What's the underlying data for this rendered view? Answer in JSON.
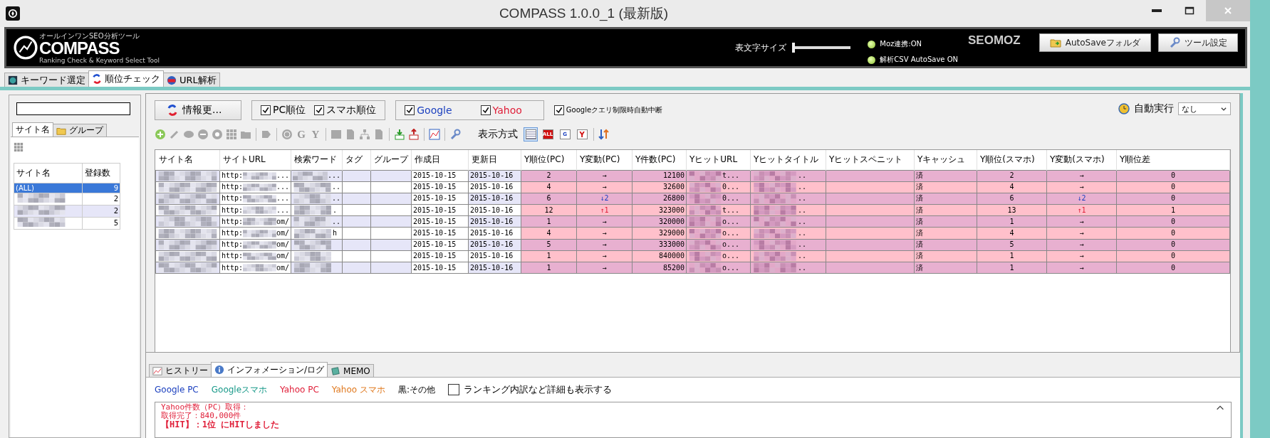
{
  "window": {
    "title": "COMPASS 1.0.0_1 (最新版)"
  },
  "banner": {
    "logo": "COMPASS",
    "logo_tagline": "オールインワンSEO分析ツール",
    "logo_subtitle": "Ranking Check & Keyword Select Tool",
    "font_size_label": "表文字サイズ",
    "font_size": {
      "level": 0
    },
    "statuses": [
      {
        "label": "Moz連携:ON",
        "on": true
      },
      {
        "label": "解析CSV AutoSave ON",
        "on": true
      }
    ],
    "partner_logo": "SEOMOZ",
    "buttons": [
      {
        "kind": "folder",
        "label": "AutoSaveフォルダ"
      },
      {
        "kind": "wrench",
        "label": "ツール設定"
      }
    ]
  },
  "main_tabs": [
    {
      "kind": "keyword",
      "label": "キーワード選定",
      "selected": false
    },
    {
      "kind": "rank",
      "label": "順位チェック",
      "selected": true
    },
    {
      "kind": "url",
      "label": "URL解析",
      "selected": false
    }
  ],
  "sidebar": {
    "tabs": [
      {
        "label": "サイト名",
        "selected": true
      },
      {
        "label": "グループ",
        "selected": false
      }
    ],
    "columns": [
      "サイト名",
      "登録数"
    ],
    "rows": [
      {
        "name": "(ALL)",
        "count": "9",
        "selected": true
      },
      {
        "blurred": true,
        "count": "2",
        "selected": false
      },
      {
        "blurred": true,
        "count": "2",
        "selected": false
      },
      {
        "blurred": true,
        "count": "5",
        "selected": false
      }
    ]
  },
  "toolbar": {
    "update_button": "情報更...",
    "device_checks": [
      {
        "label": "PC順位",
        "checked": true
      },
      {
        "label": "スマホ順位",
        "checked": true
      }
    ],
    "engine_checks": [
      {
        "label": "Google",
        "checked": true,
        "color": "#1a3fbf"
      },
      {
        "label": "Yahoo",
        "checked": true,
        "color": "#e0203a"
      }
    ],
    "auto_stop": {
      "label": "Googleクエリ制限時自動中断",
      "checked": true
    },
    "auto_run_label": "自動実行",
    "auto_run_value": "なし",
    "glyphs": [
      "G",
      "Y"
    ],
    "display_label": "表示方式",
    "display_modes": [
      {
        "kind": "list",
        "selected": true
      },
      {
        "kind": "all",
        "label": "ALL",
        "selected": false
      },
      {
        "kind": "google",
        "label": "G",
        "selected": false
      },
      {
        "kind": "yahoo",
        "label": "Y",
        "selected": false
      }
    ]
  },
  "table": {
    "columns": [
      "サイト名",
      "サイトURL",
      "検索ワード",
      "タグ",
      "グループ",
      "作成日",
      "更新日",
      "Y順位(PC)",
      "Y変動(PC)",
      "Y件数(PC)",
      "YヒットURL",
      "Yヒットタイトル",
      "Yヒットスペニット",
      "Yキャッシュ",
      "Y順位(スマホ)",
      "Y変動(スマホ)",
      "Y順位差"
    ],
    "rows": [
      {
        "url_start": "http:",
        "url_end": "...",
        "keyword_end": "...",
        "created": "2015-10-15",
        "updated": "2015-10-16",
        "rank_pc": "2",
        "change_pc": {
          "text": "→"
        },
        "count_pc": "12100",
        "hit_url_end": "t...",
        "hit_title_end": "..",
        "cache": "済",
        "rank_sp": "2",
        "change_sp": {
          "text": "→"
        },
        "diff": "0"
      },
      {
        "url_start": "http:",
        "url_end": "...",
        "keyword_end": "..",
        "created": "2015-10-15",
        "updated": "2015-10-16",
        "rank_pc": "4",
        "change_pc": {
          "text": "→"
        },
        "count_pc": "32600",
        "hit_url_end": "0...",
        "hit_title_end": "..",
        "cache": "済",
        "rank_sp": "4",
        "change_sp": {
          "text": "→"
        },
        "diff": "0"
      },
      {
        "url_start": "http:",
        "url_end": "...",
        "keyword_end": "..",
        "created": "2015-10-15",
        "updated": "2015-10-16",
        "rank_pc": "6",
        "change_pc": {
          "text": "↓2",
          "color": "#1a3fbf"
        },
        "count_pc": "26800",
        "hit_url_end": "0...",
        "hit_title_end": "..",
        "cache": "済",
        "rank_sp": "6",
        "change_sp": {
          "text": "↓2",
          "color": "#1a3fbf"
        },
        "diff": "0"
      },
      {
        "url_start": "http:",
        "url_end": "...",
        "keyword_end": ".",
        "created": "2015-10-15",
        "updated": "2015-10-16",
        "rank_pc": "12",
        "change_pc": {
          "text": "↑1",
          "color": "#e0203a"
        },
        "count_pc": "323000",
        "hit_url_end": "t...",
        "hit_title_end": "..",
        "cache": "済",
        "rank_sp": "13",
        "change_sp": {
          "text": "↑1",
          "color": "#e0203a"
        },
        "diff": "1"
      },
      {
        "url_start": "http:",
        "url_end": "om/",
        "keyword_end": "..",
        "created": "2015-10-15",
        "updated": "2015-10-16",
        "rank_pc": "1",
        "change_pc": {
          "text": "→"
        },
        "count_pc": "320000",
        "hit_url_end": "o...",
        "hit_title_end": "..",
        "cache": "済",
        "rank_sp": "1",
        "change_sp": {
          "text": "→"
        },
        "diff": "0"
      },
      {
        "url_start": "http:",
        "url_end": "om/",
        "keyword_end": "h",
        "created": "2015-10-15",
        "updated": "2015-10-16",
        "rank_pc": "4",
        "change_pc": {
          "text": "→"
        },
        "count_pc": "329000",
        "hit_url_end": "o...",
        "hit_title_end": "..",
        "cache": "済",
        "rank_sp": "4",
        "change_sp": {
          "text": "→"
        },
        "diff": "0"
      },
      {
        "url_start": "http:",
        "url_end": "om/",
        "created": "2015-10-15",
        "updated": "2015-10-16",
        "rank_pc": "5",
        "change_pc": {
          "text": "→"
        },
        "count_pc": "333000",
        "hit_url_end": "o...",
        "hit_title_end": "..",
        "cache": "済",
        "rank_sp": "5",
        "change_sp": {
          "text": "→"
        },
        "diff": "0"
      },
      {
        "url_start": "http:",
        "url_end": "om/",
        "created": "2015-10-15",
        "updated": "2015-10-16",
        "rank_pc": "1",
        "change_pc": {
          "text": "→"
        },
        "count_pc": "840000",
        "hit_url_end": "o...",
        "hit_title_end": "..",
        "cache": "済",
        "rank_sp": "1",
        "change_sp": {
          "text": "→"
        },
        "diff": "0"
      },
      {
        "url_start": "http:",
        "url_end": "om/",
        "created": "2015-10-15",
        "updated": "2015-10-16",
        "rank_pc": "1",
        "change_pc": {
          "text": "→"
        },
        "count_pc": "85200",
        "hit_url_end": "o...",
        "hit_title_end": "..",
        "cache": "済",
        "rank_sp": "1",
        "change_sp": {
          "text": "→"
        },
        "diff": "0"
      }
    ]
  },
  "bottom_tabs": [
    {
      "kind": "chart",
      "label": "ヒストリー",
      "selected": false
    },
    {
      "kind": "info",
      "label": "インフォメーション/ログ",
      "selected": true
    },
    {
      "kind": "memo",
      "label": "MEMO",
      "selected": false
    }
  ],
  "legend": [
    {
      "label": "Google PC",
      "color": "#1a3fbf"
    },
    {
      "label": "Googleスマホ",
      "color": "#1a9a8a"
    },
    {
      "label": "Yahoo PC",
      "color": "#e0203a"
    },
    {
      "label": "Yahoo スマホ",
      "color": "#e07a20"
    },
    {
      "label": "黒:その他"
    }
  ],
  "detail_check": {
    "label": "ランキング内訳など詳細も表示する",
    "checked": false
  },
  "log": [
    {
      "kind": "normal",
      "text": "Yahoo件数（PC）取得："
    },
    {
      "kind": "normal",
      "text": "取得完了：840,000件"
    },
    {
      "kind": "hit",
      "text": "【HIT】：1位 にHITしました"
    }
  ]
}
